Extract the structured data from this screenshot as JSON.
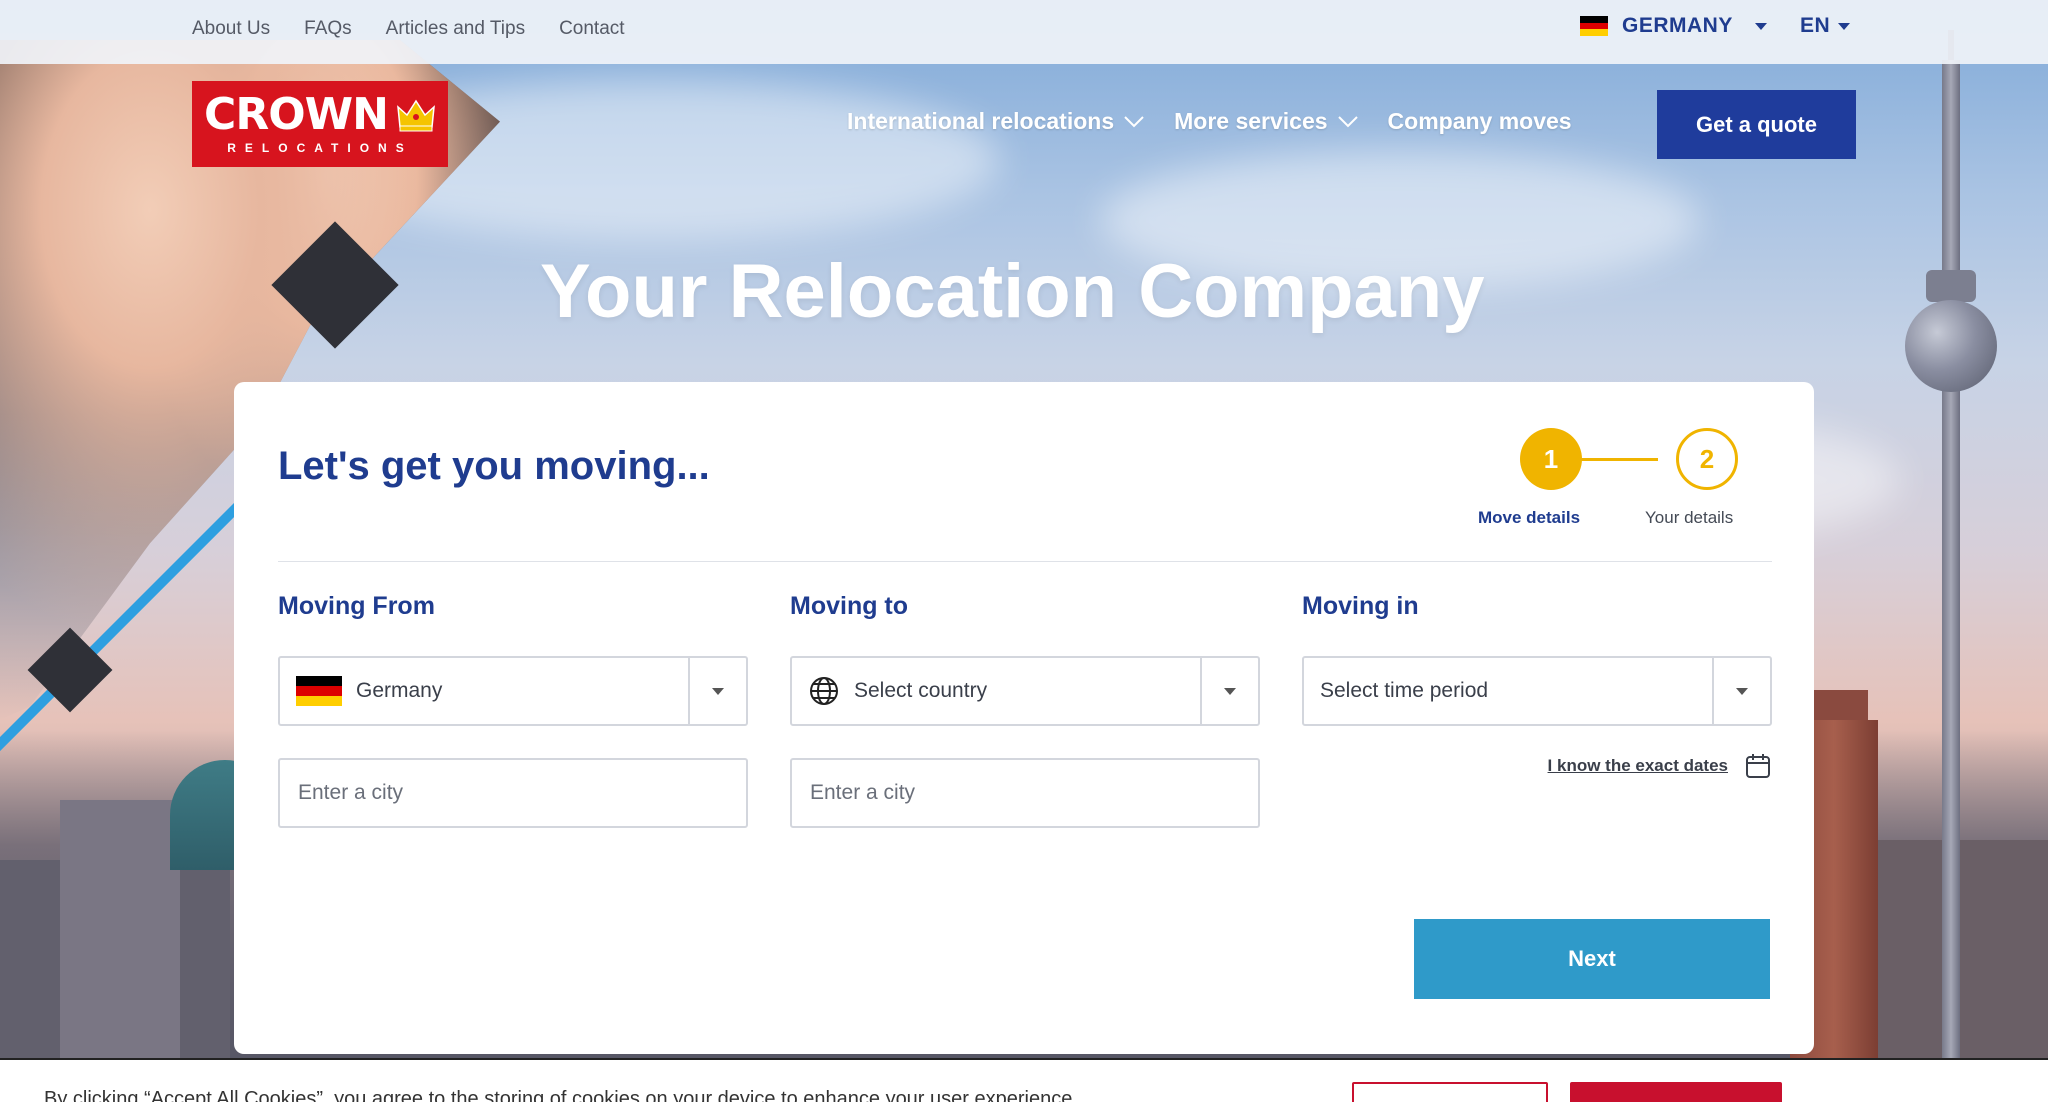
{
  "topbar": {
    "links": [
      "About Us",
      "FAQs",
      "Articles and Tips",
      "Contact"
    ],
    "region": "GERMANY",
    "language": "EN"
  },
  "logo": {
    "word": "CROWN",
    "sub": "RELOCATIONS"
  },
  "nav": {
    "items": [
      "International relocations",
      "More services",
      "Company moves"
    ],
    "cta": "Get a quote"
  },
  "hero": {
    "title": "Your Relocation Company"
  },
  "form": {
    "title": "Let's get you moving...",
    "steps": [
      {
        "number": "1",
        "label": "Move details"
      },
      {
        "number": "2",
        "label": "Your details"
      }
    ],
    "moving_from": {
      "label": "Moving From",
      "country": "Germany",
      "city_placeholder": "Enter a city"
    },
    "moving_to": {
      "label": "Moving to",
      "country": "Select country",
      "city_placeholder": "Enter a city"
    },
    "moving_in": {
      "label": "Moving in",
      "period": "Select time period",
      "exact_dates": "I know the exact dates"
    },
    "next": "Next"
  },
  "cookie": {
    "text": "By clicking “Accept All Cookies”, you agree to the storing of cookies on your device to enhance your user experience"
  },
  "colors": {
    "brand_blue": "#1f3c9c",
    "brand_red": "#d7141e",
    "step_yellow": "#f0b400",
    "next_button": "#2f9ac9"
  },
  "icons": [
    "germany-flag-icon",
    "chevron-down-icon",
    "globe-icon",
    "calendar-icon",
    "crown-icon"
  ]
}
